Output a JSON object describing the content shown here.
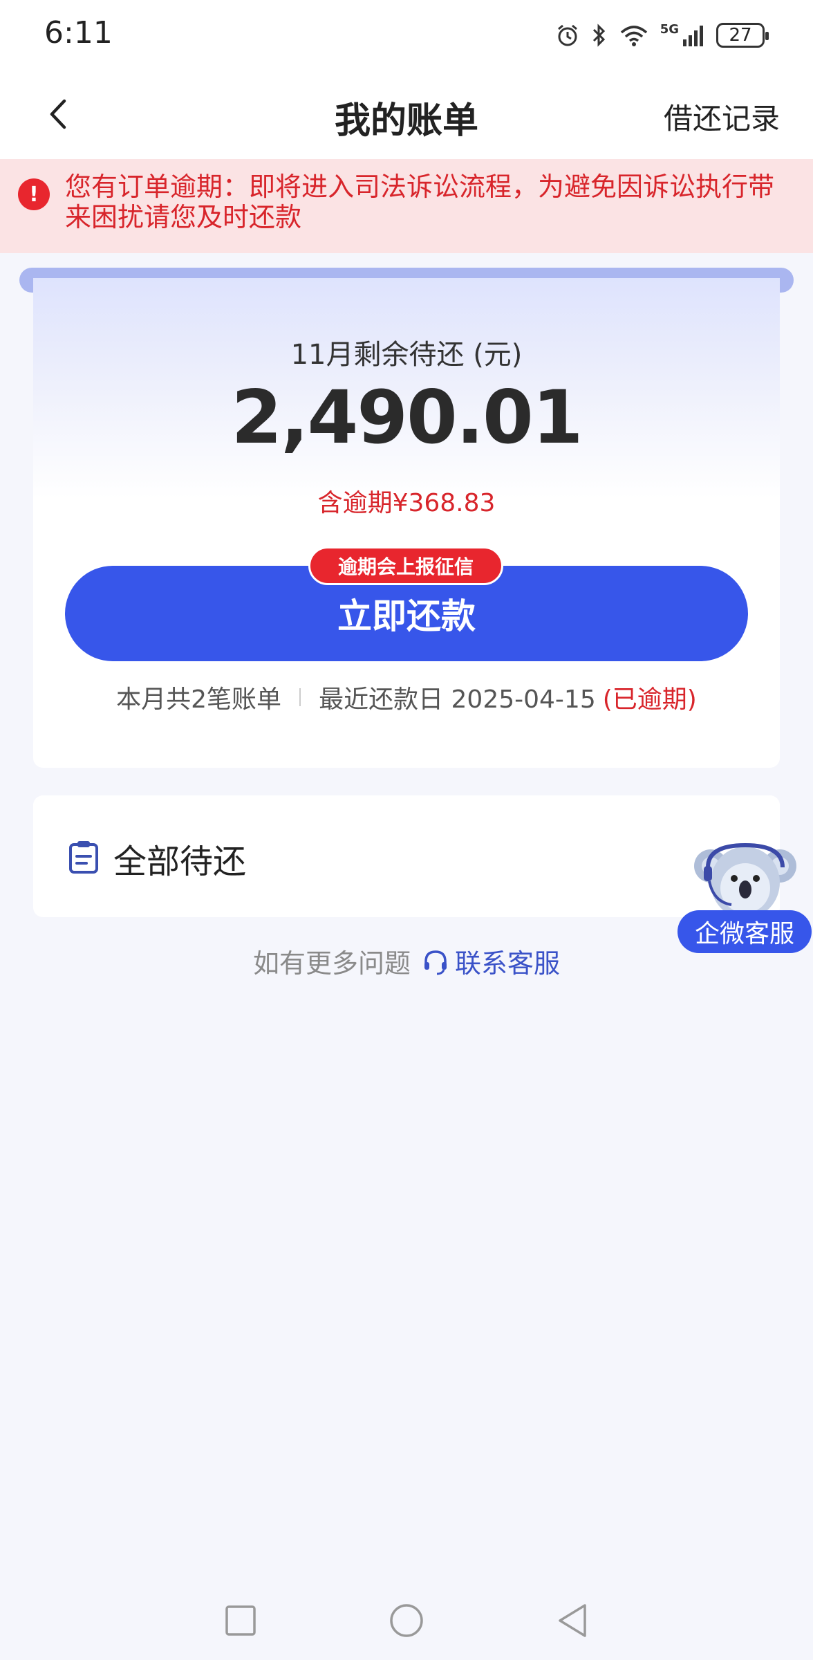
{
  "status_bar": {
    "time": "6:11",
    "network": "5G",
    "battery": "27"
  },
  "nav": {
    "title": "我的账单",
    "right_link": "借还记录"
  },
  "warning": {
    "text": "您有订单逾期：即将进入司法诉讼流程，为避免因诉讼执行带来困扰请您及时还款"
  },
  "bill": {
    "label": "11月剩余待还 (元)",
    "amount": "2,490.01",
    "overdue_amount": "含逾期¥368.83",
    "credit_badge": "逾期会上报征信",
    "pay_button": "立即还款",
    "bill_count": "本月共2笔账单",
    "due_date": "最近还款日 2025-04-15",
    "overdue_tag": "(已逾期)"
  },
  "pending": {
    "label": "全部待还"
  },
  "help": {
    "text": "如有更多问题",
    "contact": "联系客服"
  },
  "float_service": {
    "label": "企微客服"
  },
  "colors": {
    "primary": "#3756ea",
    "danger": "#d8252b",
    "warning_bg": "#fbe3e4"
  }
}
